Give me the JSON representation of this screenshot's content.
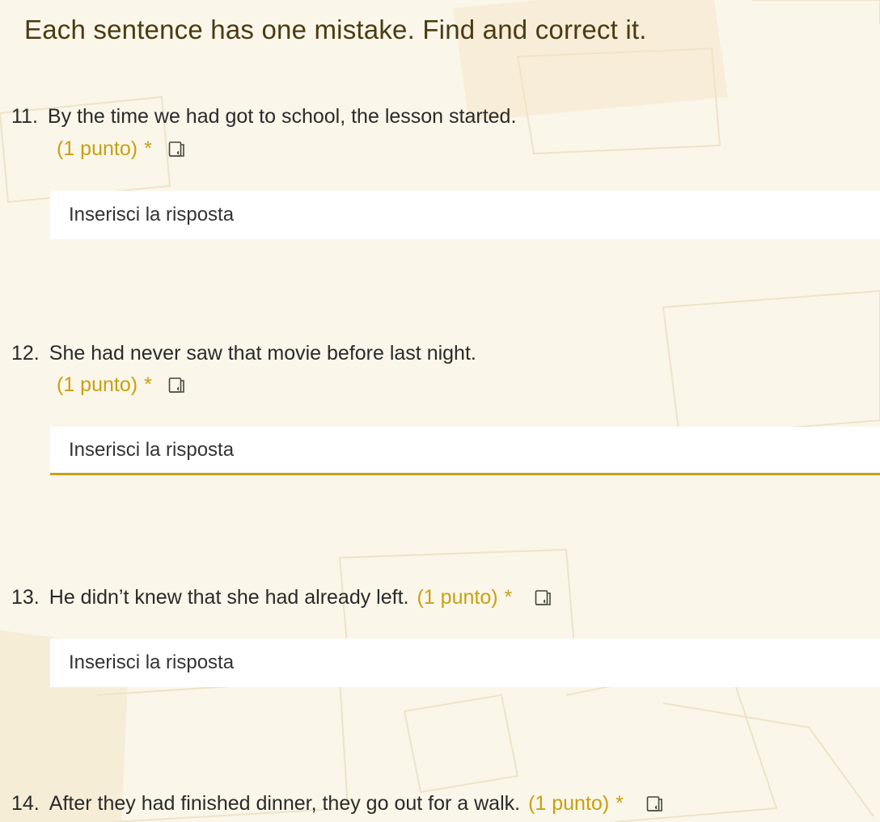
{
  "form": {
    "instruction": "Each sentence has one mistake. Find and correct it."
  },
  "questions": [
    {
      "number": "11.",
      "text": "By the time we had got to school, the lesson started.",
      "points": "(1 punto)",
      "required_mark": "*",
      "answer_placeholder": "Inserisci la risposta",
      "answer_value": ""
    },
    {
      "number": "12.",
      "text": "She had never saw that movie before last night.",
      "points": "(1 punto)",
      "required_mark": "*",
      "answer_placeholder": "Inserisci la risposta",
      "answer_value": "",
      "focused": true
    },
    {
      "number": "13.",
      "text": "He didn’t knew that she had already left.",
      "points": "(1 punto)",
      "required_mark": "*",
      "answer_placeholder": "Inserisci la risposta",
      "answer_value": ""
    },
    {
      "number": "14.",
      "text": "After they had finished dinner, they go out for a walk.",
      "points": "(1 punto)",
      "required_mark": "*"
    }
  ],
  "icons": {
    "read_aloud": "immersive-reader-icon"
  },
  "colors": {
    "accent": "#c8a012",
    "background": "#faf6e9",
    "heading": "#4a3b12"
  }
}
